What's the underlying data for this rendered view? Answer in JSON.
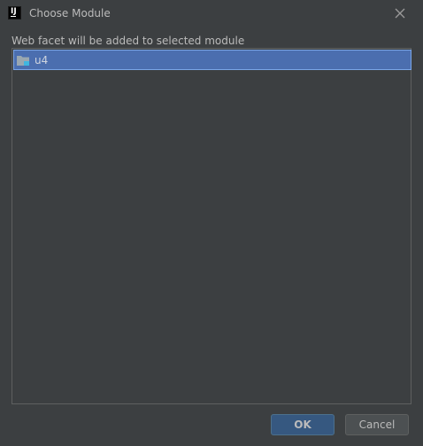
{
  "window": {
    "title": "Choose Module",
    "app_icon_text": "IJ"
  },
  "description": "Web facet will be added to selected module",
  "modules": [
    {
      "label": "u4",
      "icon": "module-folder-icon",
      "selected": true
    }
  ],
  "buttons": {
    "ok_label": "OK",
    "cancel_label": "Cancel"
  },
  "colors": {
    "background": "#3c3f41",
    "selection": "#4b6eaf",
    "ok_button": "#365880",
    "text": "#bbbbbb"
  }
}
